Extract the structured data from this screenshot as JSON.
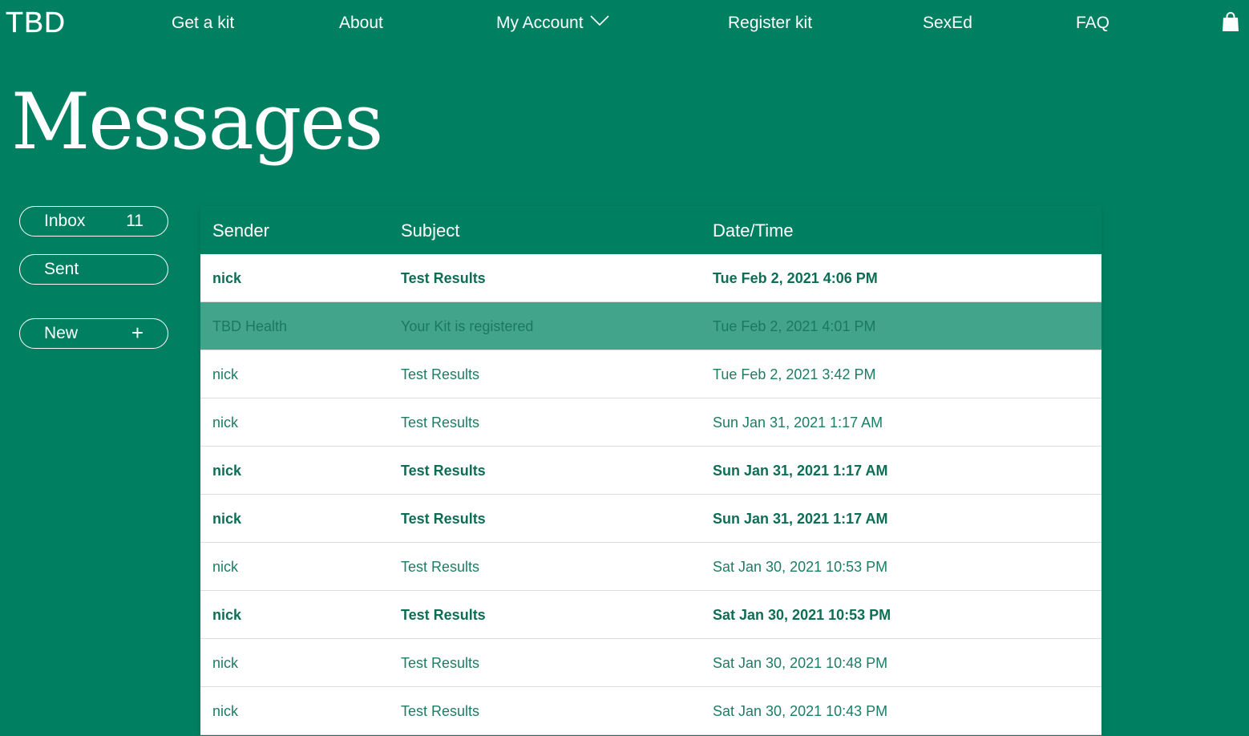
{
  "brand": {
    "logo": "TBD"
  },
  "nav": {
    "items": [
      {
        "label": "Get a kit"
      },
      {
        "label": "About"
      },
      {
        "label": "My Account"
      },
      {
        "label": "Register kit"
      },
      {
        "label": "SexEd"
      },
      {
        "label": "FAQ"
      }
    ],
    "cart_icon": "shopping-bag-icon"
  },
  "page": {
    "title": "Messages"
  },
  "sidebar": {
    "inbox": {
      "label": "Inbox",
      "count": "11"
    },
    "sent": {
      "label": "Sent"
    },
    "new": {
      "label": "New",
      "icon": "plus-icon",
      "icon_glyph": "+"
    }
  },
  "table": {
    "headers": {
      "sender": "Sender",
      "subject": "Subject",
      "datetime": "Date/Time"
    },
    "rows": [
      {
        "sender": "nick",
        "subject": "Test Results",
        "datetime": "Tue Feb 2, 2021 4:06 PM",
        "unread": true,
        "selected": false
      },
      {
        "sender": "TBD Health",
        "subject": "Your Kit is registered",
        "datetime": "Tue Feb 2, 2021 4:01 PM",
        "unread": false,
        "selected": true
      },
      {
        "sender": "nick",
        "subject": "Test Results",
        "datetime": "Tue Feb 2, 2021 3:42 PM",
        "unread": false,
        "selected": false
      },
      {
        "sender": "nick",
        "subject": "Test Results",
        "datetime": "Sun Jan 31, 2021 1:17 AM",
        "unread": false,
        "selected": false
      },
      {
        "sender": "nick",
        "subject": "Test Results",
        "datetime": "Sun Jan 31, 2021 1:17 AM",
        "unread": true,
        "selected": false
      },
      {
        "sender": "nick",
        "subject": "Test Results",
        "datetime": "Sun Jan 31, 2021 1:17 AM",
        "unread": true,
        "selected": false
      },
      {
        "sender": "nick",
        "subject": "Test Results",
        "datetime": "Sat Jan 30, 2021 10:53 PM",
        "unread": false,
        "selected": false
      },
      {
        "sender": "nick",
        "subject": "Test Results",
        "datetime": "Sat Jan 30, 2021 10:53 PM",
        "unread": true,
        "selected": false
      },
      {
        "sender": "nick",
        "subject": "Test Results",
        "datetime": "Sat Jan 30, 2021 10:48 PM",
        "unread": false,
        "selected": false
      },
      {
        "sender": "nick",
        "subject": "Test Results",
        "datetime": "Sat Jan 30, 2021 10:43 PM",
        "unread": false,
        "selected": false
      }
    ]
  },
  "colors": {
    "background": "#008061",
    "selected_row": "#41a48b",
    "row_text": "#1c7d63",
    "row_background": "#ffffff"
  }
}
